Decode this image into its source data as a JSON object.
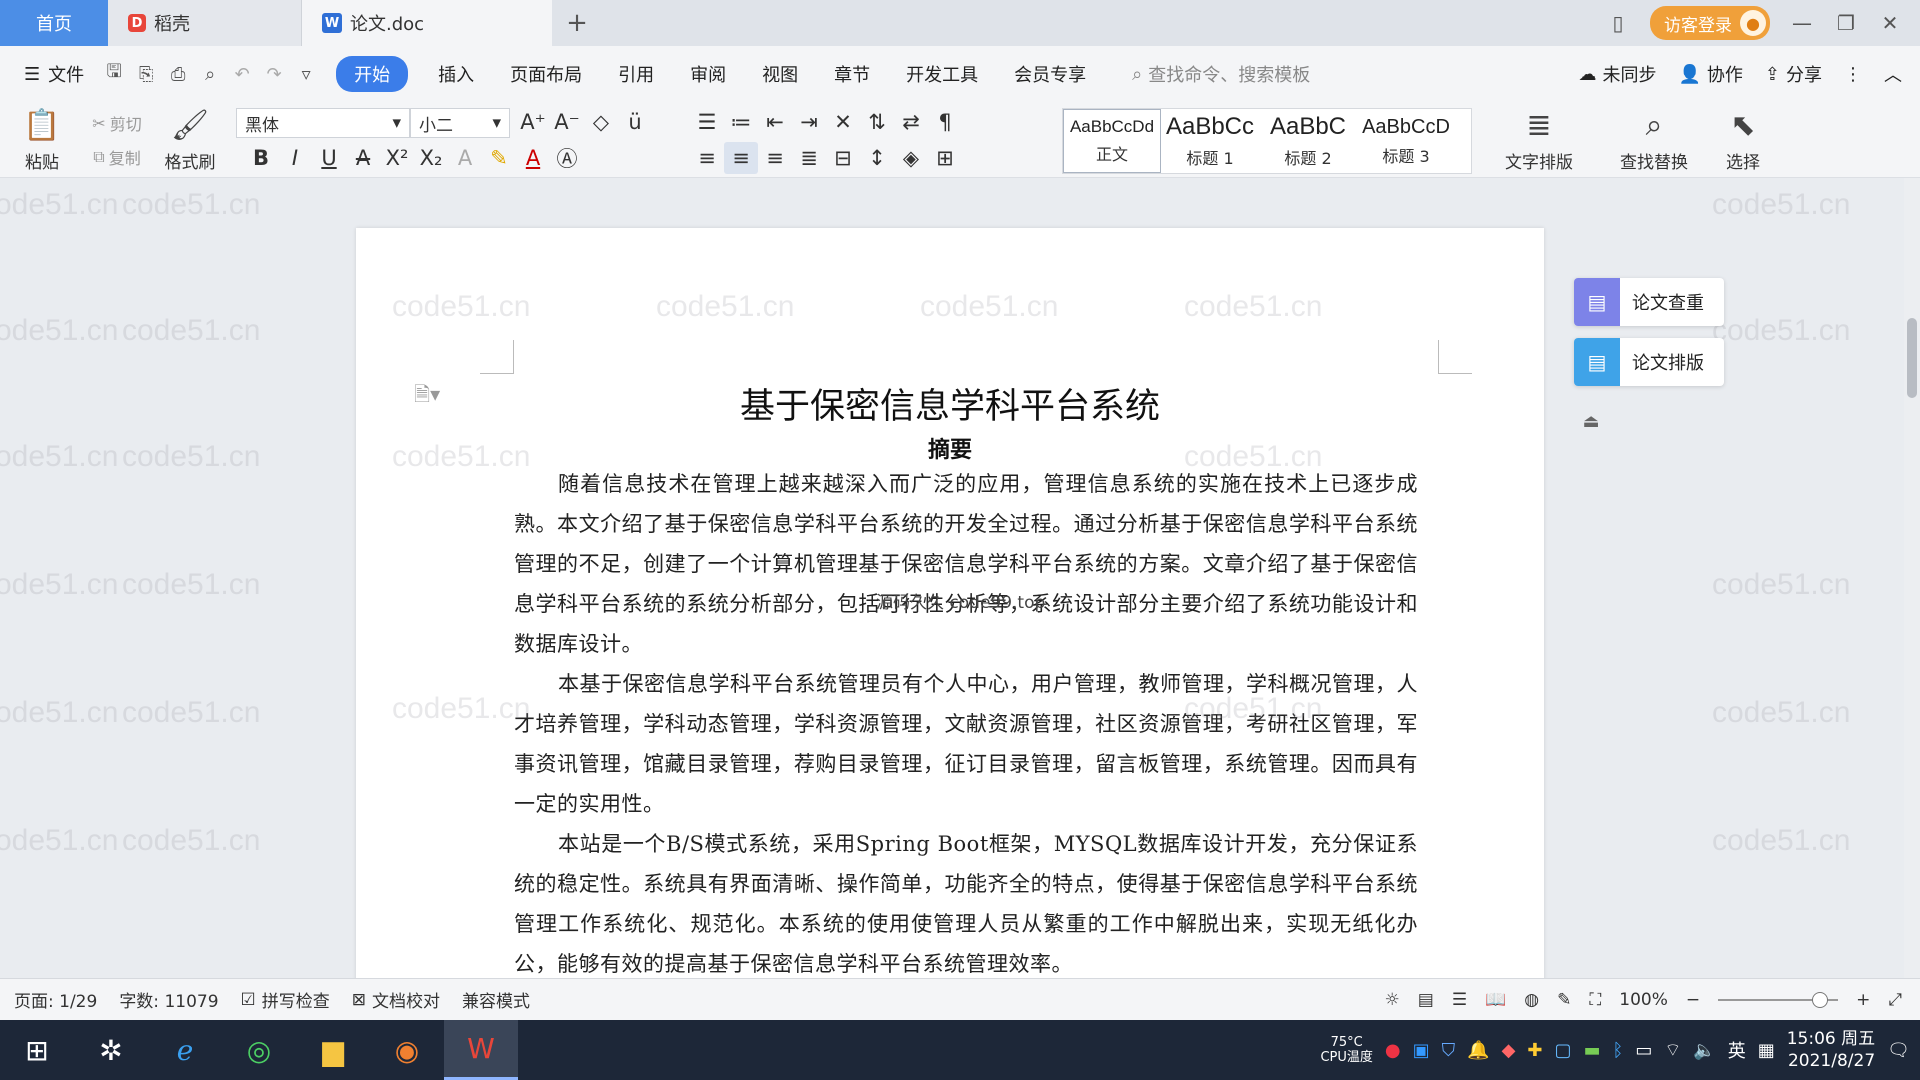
{
  "tabs": {
    "home": "首页",
    "docer": "稻壳",
    "document": "论文.doc"
  },
  "titlebar": {
    "visitor_login": "访客登录"
  },
  "menu": {
    "file": "文件",
    "items": [
      "开始",
      "插入",
      "页面布局",
      "引用",
      "审阅",
      "视图",
      "章节",
      "开发工具",
      "会员专享"
    ],
    "search_placeholder": "查找命令、搜索模板",
    "unsynced": "未同步",
    "collaborate": "协作",
    "share": "分享"
  },
  "ribbon": {
    "paste": "粘贴",
    "cut": "剪切",
    "copy": "复制",
    "format_painter": "格式刷",
    "font_name": "黑体",
    "font_size": "小二",
    "styles": [
      {
        "sample": "AaBbCcDd",
        "label": "正文"
      },
      {
        "sample": "AaBbCc",
        "label": "标题 1"
      },
      {
        "sample": "AaBbC",
        "label": "标题 2"
      },
      {
        "sample": "AaBbCcD",
        "label": "标题 3"
      }
    ],
    "text_layout": "文字排版",
    "find_replace": "查找替换",
    "select": "选择"
  },
  "document": {
    "title": "基于保密信息学科平台系统",
    "subtitle": "摘要",
    "paragraphs": [
      "随着信息技术在管理上越来越深入而广泛的应用，管理信息系统的实施在技术上已逐步成熟。本文介绍了基于保密信息学科平台系统的开发全过程。通过分析基于保密信息学科平台系统管理的不足，创建了一个计算机管理基于保密信息学科平台系统的方案。文章介绍了基于保密信息学科平台系统的系统分析部分，包括可行性分析等，系统设计部分主要介绍了系统功能设计和数据库设计。",
      "本基于保密信息学科平台系统管理员有个人中心，用户管理，教师管理，学科概况管理，人才培养管理，学科动态管理，学科资源管理，文献资源管理，社区资源管理，考研社区管理，军事资讯管理，馆藏目录管理，荐购目录管理，征订目录管理，留言板管理，系统管理。因而具有一定的实用性。",
      "本站是一个B/S模式系统，采用Spring Boot框架，MYSQL数据库设计开发，充分保证系统的稳定性。系统具有界面清晰、操作简单，功能齐全的特点，使得基于保密信息学科平台系统管理工作系统化、规范化。本系统的使用使管理人员从繁重的工作中解脱出来，实现无纸化办公，能够有效的提高基于保密信息学科平台系统管理效率。"
    ],
    "overlay_text": "源码久久 code99.top",
    "watermark": "code51.cn"
  },
  "side_panel": {
    "check": "论文查重",
    "layout": "论文排版"
  },
  "status": {
    "page": "页面: 1/29",
    "words": "字数: 11079",
    "spell_check": "拼写检查",
    "proofread": "文档校对",
    "compat": "兼容模式",
    "zoom": "100%"
  },
  "taskbar": {
    "temp": "75°C",
    "cpu_label": "CPU温度",
    "ime": "英",
    "time": "15:06 周五",
    "date": "2021/8/27"
  },
  "colors": {
    "accent": "#3b7de9",
    "home_tab": "#4c8ee6",
    "visitor": "#f0a03a",
    "taskbar": "#1d2738"
  }
}
